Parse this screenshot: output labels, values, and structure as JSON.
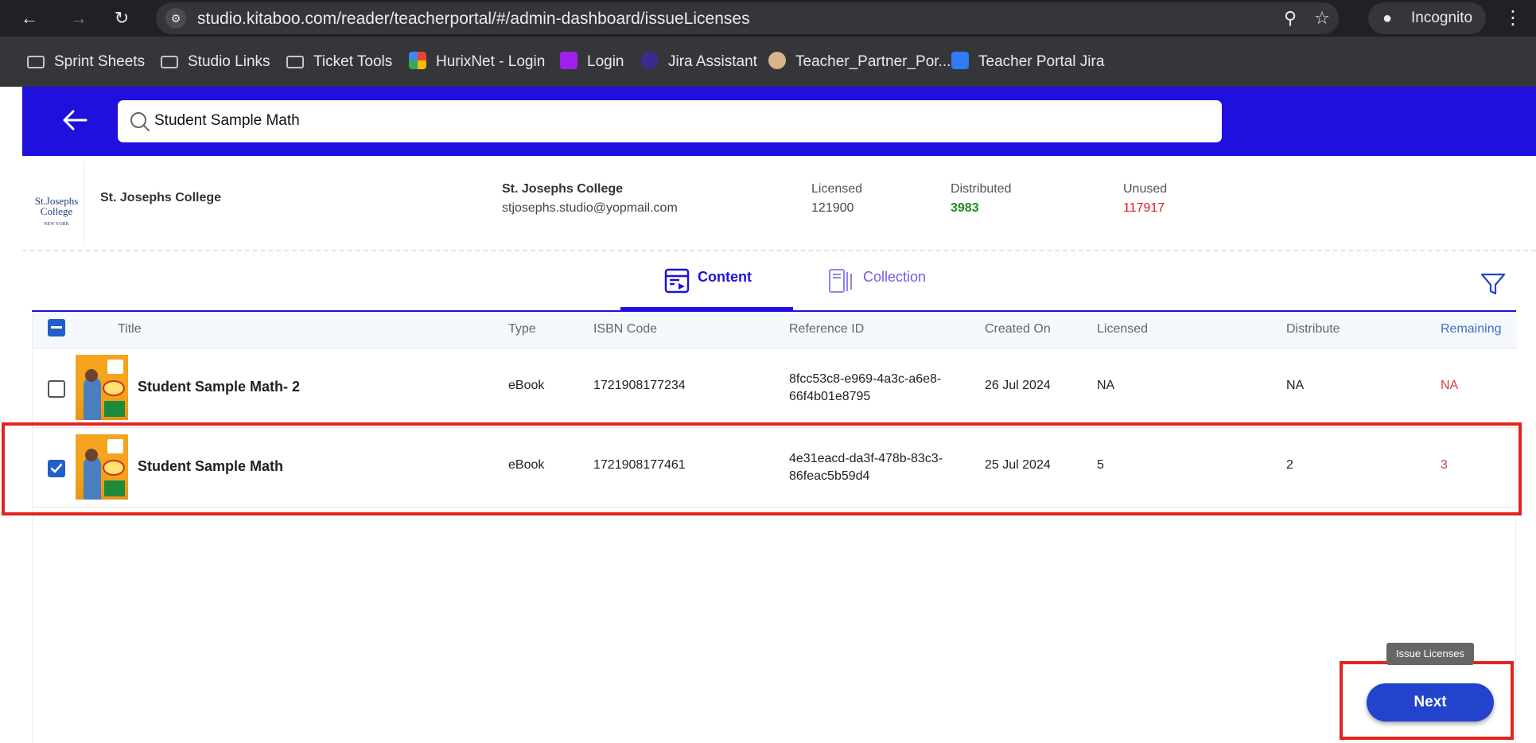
{
  "browser": {
    "url": "studio.kitaboo.com/reader/teacherportal/#/admin-dashboard/issueLicenses",
    "incognito_label": "Incognito",
    "bookmarks": [
      {
        "label": "Sprint Sheets",
        "icon": "folder-icon"
      },
      {
        "label": "Studio Links",
        "icon": "folder-icon"
      },
      {
        "label": "Ticket Tools",
        "icon": "folder-icon"
      },
      {
        "label": "HurixNet - Login",
        "icon": "hurix-favicon"
      },
      {
        "label": "Login",
        "icon": "login-favicon"
      },
      {
        "label": "Jira Assistant",
        "icon": "jira-assistant-favicon"
      },
      {
        "label": "Teacher_Partner_Por...",
        "icon": "teacher-partner-favicon"
      },
      {
        "label": "Teacher Portal Jira",
        "icon": "jira-favicon"
      }
    ]
  },
  "header": {
    "search_value": "Student Sample Math",
    "colors": {
      "accent": "#1f10de"
    }
  },
  "institution": {
    "logo_text_1": "St.Josephs",
    "logo_text_2": "College",
    "logo_text_3": "NEW YORK",
    "name": "St. Josephs College",
    "contact_name": "St. Josephs College",
    "contact_email": "stjosephs.studio@yopmail.com",
    "licensed_label": "Licensed",
    "licensed_value": "121900",
    "distributed_label": "Distributed",
    "distributed_value": "3983",
    "unused_label": "Unused",
    "unused_value": "117917",
    "colors": {
      "distributed": "#1e8f1e",
      "unused": "#e0191b"
    }
  },
  "tabs": {
    "content_label": "Content",
    "collection_label": "Collection"
  },
  "table": {
    "headers": {
      "title": "Title",
      "type": "Type",
      "isbn": "ISBN Code",
      "reference": "Reference ID",
      "created": "Created On",
      "licensed": "Licensed",
      "distribute": "Distribute",
      "remaining": "Remaining"
    },
    "rows": [
      {
        "checked": false,
        "title": "Student Sample Math- 2",
        "type": "eBook",
        "isbn": "1721908177234",
        "ref_line1": "8fcc53c8-e969-4a3c-a6e8-",
        "ref_line2": "66f4b01e8795",
        "created": "26 Jul 2024",
        "licensed": "NA",
        "distribute": "NA",
        "remaining": "NA"
      },
      {
        "checked": true,
        "title": "Student Sample Math",
        "type": "eBook",
        "isbn": "1721908177461",
        "ref_line1": "4e31eacd-da3f-478b-83c3-",
        "ref_line2": "86feac5b59d4",
        "created": "25 Jul 2024",
        "licensed": "5",
        "distribute": "2",
        "remaining": "3"
      }
    ]
  },
  "footer": {
    "tooltip": "Issue Licenses",
    "next_label": "Next"
  }
}
